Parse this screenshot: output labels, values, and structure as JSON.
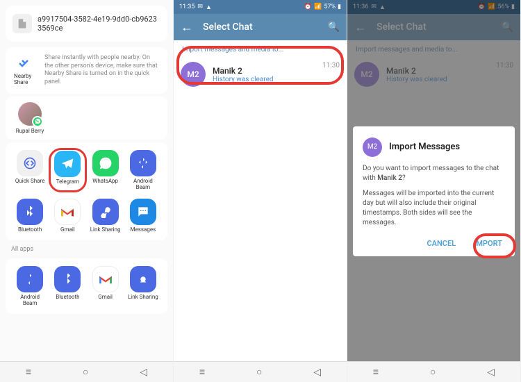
{
  "panel1": {
    "filename": "a9917504-3582-4e19-9dd0-cb96233569ce",
    "nearby": {
      "label": "Nearby Share",
      "desc": "Share instantly with people nearby. On the other person's device, make sure that Nearby Share is turned on in the quick panel."
    },
    "contact": {
      "name": "Rupal Berry"
    },
    "apps_row1": [
      {
        "label": "Quick Share"
      },
      {
        "label": "Telegram"
      },
      {
        "label": "WhatsApp"
      },
      {
        "label": "Android Beam"
      }
    ],
    "apps_row2": [
      {
        "label": "Bluetooth"
      },
      {
        "label": "Gmail"
      },
      {
        "label": "Link Sharing"
      },
      {
        "label": "Messages"
      }
    ],
    "allapps_label": "All apps",
    "apps_row3": [
      {
        "label": "Android Beam"
      },
      {
        "label": "Bluetooth"
      },
      {
        "label": "Gmail"
      },
      {
        "label": "Link Sharing"
      }
    ]
  },
  "panel2": {
    "status": {
      "time": "11:35",
      "battery": "57%"
    },
    "header": "Select Chat",
    "import_hdr": "Import messages and media to...",
    "chat": {
      "avatar": "M2",
      "name": "Manik 2",
      "sub": "History was cleared",
      "time": "11:30"
    }
  },
  "panel3": {
    "status": {
      "time": "11:36",
      "battery": "56%"
    },
    "header": "Select Chat",
    "import_hdr": "Import messages and media to...",
    "chat": {
      "avatar": "M2",
      "name": "Manik 2",
      "sub": "History was cleared",
      "time": "11:30"
    },
    "dialog": {
      "avatar": "M2",
      "title": "Import Messages",
      "q1": "Do you want to import messages to the chat with ",
      "q1b": "Manik 2",
      "q1c": "?",
      "note": "Messages will be imported into the current day but will also include their original timestamps. Both sides will see the messages.",
      "cancel": "CANCEL",
      "import": "IMPORT"
    }
  }
}
